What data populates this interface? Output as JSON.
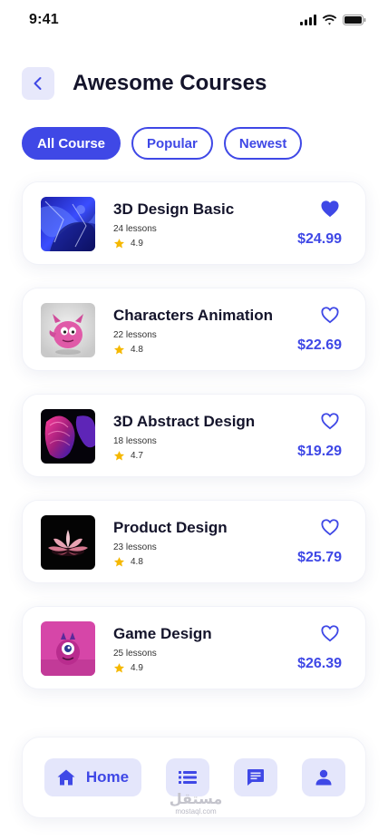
{
  "status_bar": {
    "time": "9:41"
  },
  "header": {
    "title": "Awesome Courses"
  },
  "filters": [
    {
      "label": "All Course",
      "active": true
    },
    {
      "label": "Popular",
      "active": false
    },
    {
      "label": "Newest",
      "active": false
    }
  ],
  "courses": [
    {
      "title": "3D Design Basic",
      "lessons": "24 lessons",
      "rating": "4.9",
      "price": "$24.99",
      "favorited": true,
      "thumb": "blue-crystal"
    },
    {
      "title": "Characters Animation",
      "lessons": "22 lessons",
      "rating": "4.8",
      "price": "$22.69",
      "favorited": false,
      "thumb": "pink-character"
    },
    {
      "title": "3D Abstract Design",
      "lessons": "18 lessons",
      "rating": "4.7",
      "price": "$19.29",
      "favorited": false,
      "thumb": "abstract-shape"
    },
    {
      "title": "Product Design",
      "lessons": "23 lessons",
      "rating": "4.8",
      "price": "$25.79",
      "favorited": false,
      "thumb": "lotus-flower"
    },
    {
      "title": "Game Design",
      "lessons": "25 lessons",
      "rating": "4.9",
      "price": "$26.39",
      "favorited": false,
      "thumb": "pink-monster"
    }
  ],
  "bottom_nav": {
    "home_label": "Home",
    "items": [
      "home-icon",
      "list-icon",
      "chat-icon",
      "profile-icon"
    ]
  },
  "watermark": {
    "arabic": "مستقل",
    "latin": "mostaql.com"
  },
  "colors": {
    "accent": "#3f48e6",
    "accent_soft": "#e4e6fb",
    "star": "#f5b800",
    "title": "#14142b"
  }
}
